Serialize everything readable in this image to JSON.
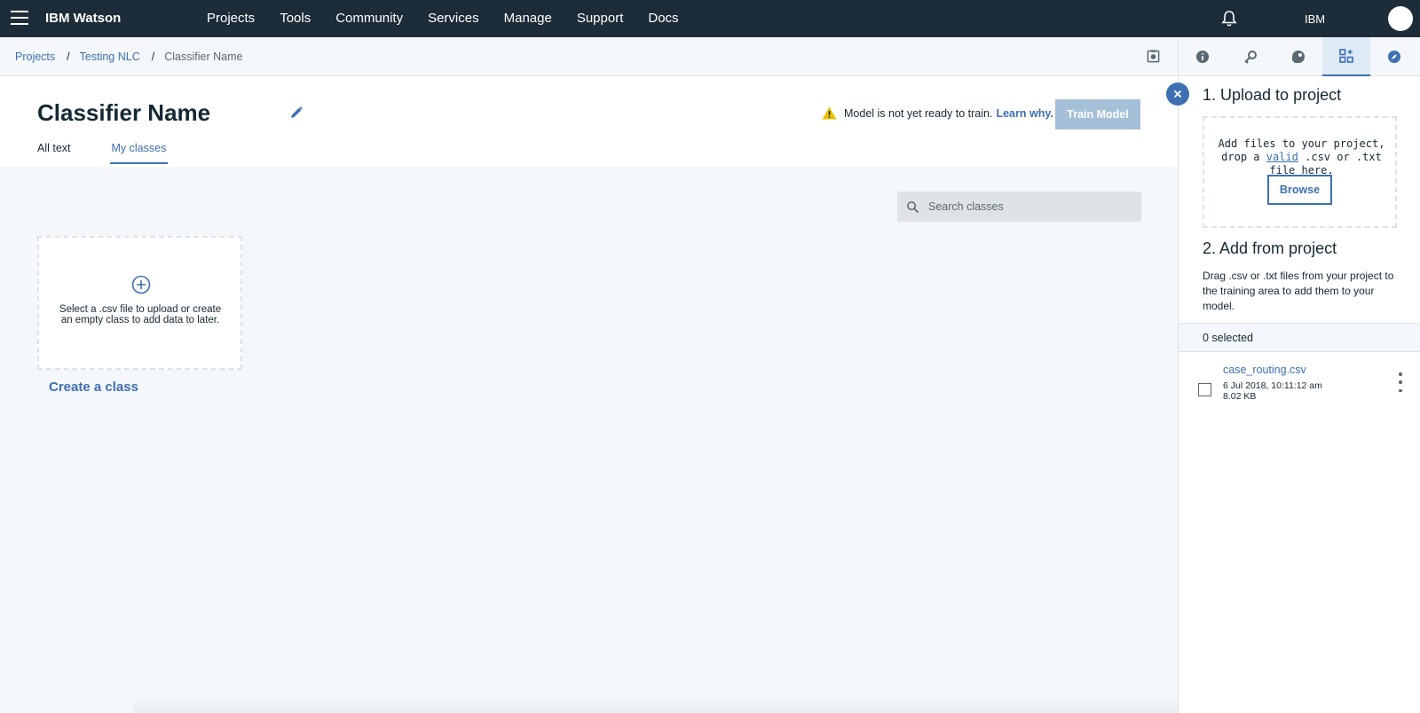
{
  "topnav": {
    "brand": "IBM Watson",
    "links": [
      "Projects",
      "Tools",
      "Community",
      "Services",
      "Manage",
      "Support",
      "Docs"
    ],
    "org": "IBM"
  },
  "breadcrumb": {
    "items": [
      "Projects",
      "Testing NLC"
    ],
    "current": "Classifier Name",
    "separator": "/"
  },
  "header": {
    "title": "Classifier Name",
    "warning_text": "Model is not yet ready to train.",
    "warning_link": "Learn why.",
    "train_button": "Train Model",
    "tabs": [
      {
        "label": "All text",
        "active": false
      },
      {
        "label": "My classes",
        "active": true
      }
    ]
  },
  "search": {
    "placeholder": "Search classes"
  },
  "create_card": {
    "text": "Select a .csv file to upload or create an empty class to add data to later.",
    "link": "Create a class"
  },
  "right_panel": {
    "tab_icons": [
      "info-icon",
      "lock-key-icon",
      "palette-icon",
      "data-assets-icon",
      "compass-icon"
    ],
    "active_tab": "data-assets-icon",
    "upload_heading": "1. Upload to project",
    "dropzone_pre": "Add files to your project, drop a",
    "dropzone_valid": "valid",
    "dropzone_post": ".csv or .txt file here.",
    "browse_button": "Browse",
    "add_heading": "2. Add from project",
    "add_description": "Drag .csv or .txt files from your project to the training area to add them to your model.",
    "selected_count": "0 selected",
    "files": [
      {
        "name": "case_routing.csv",
        "date": "6 Jul 2018, 10:11:12 am",
        "size": "8.02 KB",
        "checked": false
      }
    ]
  },
  "colors": {
    "nav_bg": "#1d2c39",
    "accent": "#3d70b2",
    "disabled_button": "#a6bfd9",
    "warning": "#efc100",
    "page_bg": "#f4f7fb"
  }
}
